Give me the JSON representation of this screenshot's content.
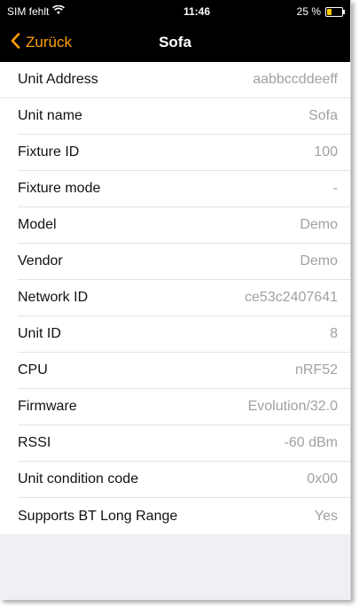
{
  "status_bar": {
    "carrier": "SIM fehlt",
    "time": "11:46",
    "battery": "25 %",
    "wifi_icon": "wifi-icon",
    "battery_icon": "battery-charging-icon"
  },
  "nav": {
    "back_label": "Zurück",
    "title": "Sofa",
    "accent_color": "#ff9f0a"
  },
  "rows": [
    {
      "label": "Unit Address",
      "value": "aabbccddeeff"
    },
    {
      "label": "Unit name",
      "value": "Sofa"
    },
    {
      "label": "Fixture ID",
      "value": "100"
    },
    {
      "label": "Fixture mode",
      "value": "-"
    },
    {
      "label": "Model",
      "value": "Demo"
    },
    {
      "label": "Vendor",
      "value": "Demo"
    },
    {
      "label": "Network ID",
      "value": "ce53c2407641"
    },
    {
      "label": "Unit ID",
      "value": "8"
    },
    {
      "label": "CPU",
      "value": "nRF52"
    },
    {
      "label": "Firmware",
      "value": "Evolution/32.0"
    },
    {
      "label": "RSSI",
      "value": "-60 dBm"
    },
    {
      "label": "Unit condition code",
      "value": "0x00"
    },
    {
      "label": "Supports BT Long Range",
      "value": "Yes"
    }
  ]
}
